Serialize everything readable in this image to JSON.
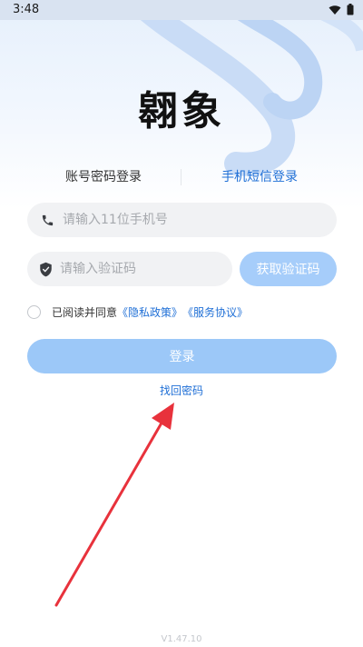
{
  "status_bar": {
    "time": "3:48",
    "icons": [
      "wifi-icon",
      "battery-icon"
    ]
  },
  "logo": {
    "text": "翱象"
  },
  "tabs": {
    "account": "账号密码登录",
    "sms": "手机短信登录",
    "active": "sms"
  },
  "phone_field": {
    "placeholder": "请输入11位手机号",
    "value": "",
    "icon": "phone-icon"
  },
  "code_field": {
    "placeholder": "请输入验证码",
    "value": "",
    "icon": "shield-icon"
  },
  "get_code_button": {
    "label": "获取验证码"
  },
  "agreement": {
    "checked": false,
    "prefix": "已阅读并同意",
    "privacy": "《隐私政策》",
    "service": "《服务协议》"
  },
  "login_button": {
    "label": "登录"
  },
  "forgot_password": {
    "label": "找回密码"
  },
  "version": "V1.47.10",
  "colors": {
    "accent": "#1f6fd6",
    "button_disabled": "#9cc8f8",
    "field_bg": "#f1f2f4",
    "annotation_arrow": "#e8323c"
  }
}
